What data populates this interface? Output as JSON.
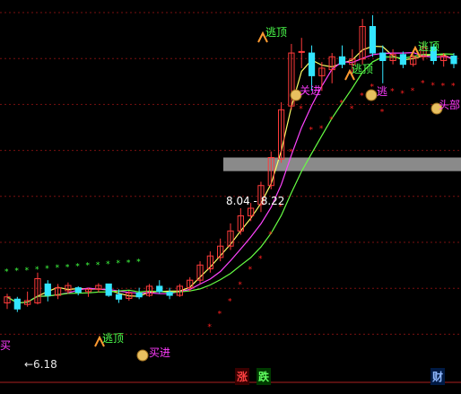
{
  "price_band": {
    "low": "8.04",
    "sep": "-",
    "high": "8.22"
  },
  "low_marker": "←6.18",
  "signals": {
    "top": "逃顶",
    "buy": "买进",
    "head": "头部",
    "short_buy": "买",
    "short_top": "逃",
    "cut": "关进"
  },
  "bottom_bar": {
    "rise": "涨",
    "fall": "跌",
    "finance": "财"
  },
  "colors": {
    "up": "#ff3b3b",
    "down": "#33e5ff",
    "ma_fast": "#ffff66",
    "ma_mid": "#ff44ff",
    "ma_slow": "#66ff44"
  },
  "chart_data": {
    "type": "candlestick",
    "ylim": [
      5.5,
      10.3
    ],
    "candles": [
      {
        "o": 6.3,
        "h": 6.42,
        "l": 6.22,
        "c": 6.38
      },
      {
        "o": 6.35,
        "h": 6.38,
        "l": 6.18,
        "c": 6.22
      },
      {
        "o": 6.28,
        "h": 6.45,
        "l": 6.25,
        "c": 6.33
      },
      {
        "o": 6.3,
        "h": 6.7,
        "l": 6.28,
        "c": 6.62
      },
      {
        "o": 6.55,
        "h": 6.6,
        "l": 6.32,
        "c": 6.4
      },
      {
        "o": 6.4,
        "h": 6.55,
        "l": 6.35,
        "c": 6.5
      },
      {
        "o": 6.46,
        "h": 6.57,
        "l": 6.42,
        "c": 6.53
      },
      {
        "o": 6.5,
        "h": 6.52,
        "l": 6.4,
        "c": 6.44
      },
      {
        "o": 6.45,
        "h": 6.5,
        "l": 6.38,
        "c": 6.48
      },
      {
        "o": 6.48,
        "h": 6.56,
        "l": 6.44,
        "c": 6.53
      },
      {
        "o": 6.55,
        "h": 6.55,
        "l": 6.38,
        "c": 6.4
      },
      {
        "o": 6.41,
        "h": 6.48,
        "l": 6.3,
        "c": 6.35
      },
      {
        "o": 6.36,
        "h": 6.46,
        "l": 6.33,
        "c": 6.43
      },
      {
        "o": 6.43,
        "h": 6.5,
        "l": 6.35,
        "c": 6.38
      },
      {
        "o": 6.4,
        "h": 6.55,
        "l": 6.38,
        "c": 6.52
      },
      {
        "o": 6.52,
        "h": 6.6,
        "l": 6.42,
        "c": 6.45
      },
      {
        "o": 6.44,
        "h": 6.5,
        "l": 6.35,
        "c": 6.4
      },
      {
        "o": 6.4,
        "h": 6.55,
        "l": 6.38,
        "c": 6.52
      },
      {
        "o": 6.5,
        "h": 6.64,
        "l": 6.45,
        "c": 6.6
      },
      {
        "o": 6.6,
        "h": 6.85,
        "l": 6.55,
        "c": 6.8
      },
      {
        "o": 6.75,
        "h": 6.98,
        "l": 6.7,
        "c": 6.92
      },
      {
        "o": 6.9,
        "h": 7.15,
        "l": 6.85,
        "c": 7.05
      },
      {
        "o": 7.05,
        "h": 7.35,
        "l": 7.0,
        "c": 7.25
      },
      {
        "o": 7.25,
        "h": 7.55,
        "l": 7.2,
        "c": 7.45
      },
      {
        "o": 7.45,
        "h": 7.62,
        "l": 7.38,
        "c": 7.55
      },
      {
        "o": 7.6,
        "h": 7.9,
        "l": 7.5,
        "c": 7.85
      },
      {
        "o": 7.85,
        "h": 8.3,
        "l": 7.8,
        "c": 8.22
      },
      {
        "o": 8.2,
        "h": 8.95,
        "l": 8.15,
        "c": 8.85
      },
      {
        "o": 8.9,
        "h": 9.72,
        "l": 8.85,
        "c": 9.6
      },
      {
        "o": 9.62,
        "h": 9.8,
        "l": 9.4,
        "c": 9.62
      },
      {
        "o": 9.6,
        "h": 9.7,
        "l": 9.1,
        "c": 9.3
      },
      {
        "o": 9.3,
        "h": 9.48,
        "l": 9.1,
        "c": 9.4
      },
      {
        "o": 9.38,
        "h": 9.6,
        "l": 9.2,
        "c": 9.55
      },
      {
        "o": 9.55,
        "h": 9.7,
        "l": 9.4,
        "c": 9.45
      },
      {
        "o": 9.45,
        "h": 9.65,
        "l": 9.3,
        "c": 9.52
      },
      {
        "o": 9.52,
        "h": 10.05,
        "l": 9.45,
        "c": 9.95
      },
      {
        "o": 9.95,
        "h": 10.1,
        "l": 9.55,
        "c": 9.6
      },
      {
        "o": 9.6,
        "h": 9.7,
        "l": 9.2,
        "c": 9.5
      },
      {
        "o": 9.5,
        "h": 9.65,
        "l": 9.45,
        "c": 9.58
      },
      {
        "o": 9.58,
        "h": 9.62,
        "l": 9.4,
        "c": 9.45
      },
      {
        "o": 9.45,
        "h": 9.58,
        "l": 9.42,
        "c": 9.55
      },
      {
        "o": 9.55,
        "h": 9.75,
        "l": 9.5,
        "c": 9.68
      },
      {
        "o": 9.68,
        "h": 9.72,
        "l": 9.45,
        "c": 9.5
      },
      {
        "o": 9.5,
        "h": 9.6,
        "l": 9.42,
        "c": 9.56
      },
      {
        "o": 9.56,
        "h": 9.6,
        "l": 9.4,
        "c": 9.46
      }
    ]
  }
}
